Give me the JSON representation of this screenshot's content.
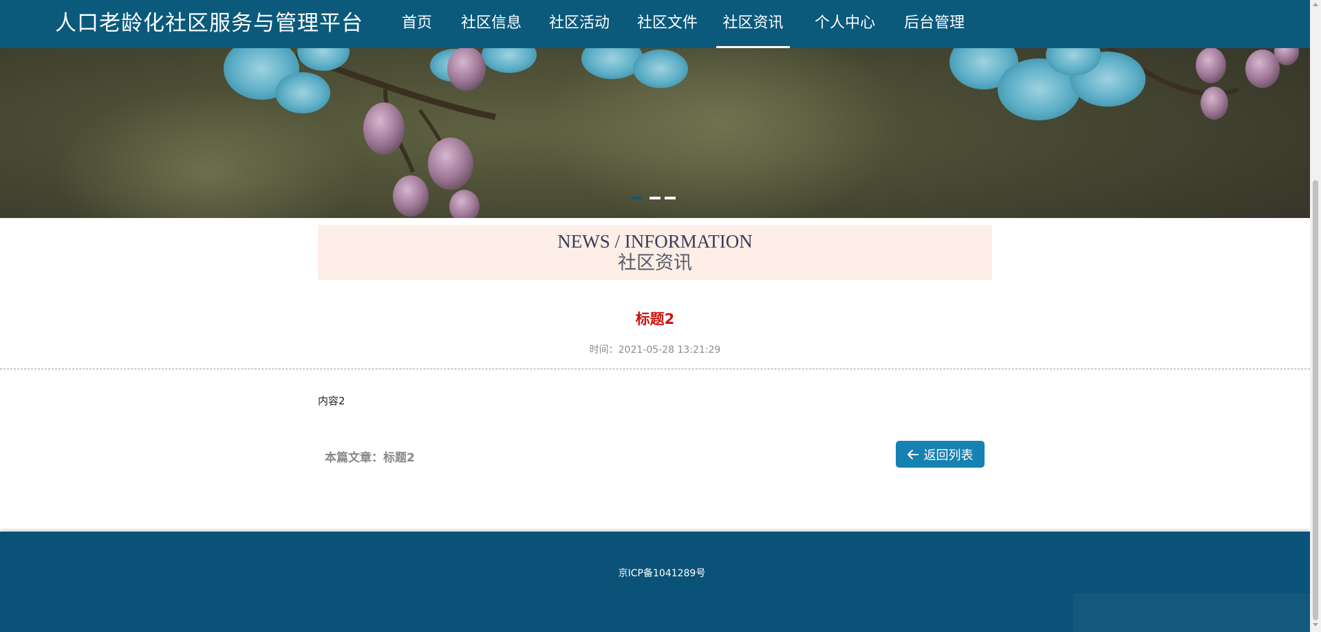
{
  "header": {
    "site_title": "人口老龄化社区服务与管理平台",
    "nav": [
      {
        "label": "首页",
        "active": false
      },
      {
        "label": "社区信息",
        "active": false
      },
      {
        "label": "社区活动",
        "active": false
      },
      {
        "label": "社区文件",
        "active": false
      },
      {
        "label": "社区资讯",
        "active": true
      },
      {
        "label": "个人中心",
        "active": false
      },
      {
        "label": "后台管理",
        "active": false
      }
    ]
  },
  "banner": {
    "slide_count": 3,
    "active_slide": 1
  },
  "section": {
    "title_en": "NEWS / INFORMATION",
    "title_cn": "社区资讯"
  },
  "article": {
    "title": "标题2",
    "time": "时间：2021-05-28 13:21:29",
    "content": "内容2",
    "current_label": "本篇文章：标题2",
    "back_label": "返回列表"
  },
  "footer": {
    "icp": "京ICP备1041289号"
  },
  "colors": {
    "header_bg": "#0b5a7c",
    "footer_bg": "#0b5278",
    "title_red": "#c9140f",
    "button_blue": "#1681b3",
    "section_bg": "#fdeee7"
  },
  "icons": {
    "back": "arrow-left-icon"
  }
}
